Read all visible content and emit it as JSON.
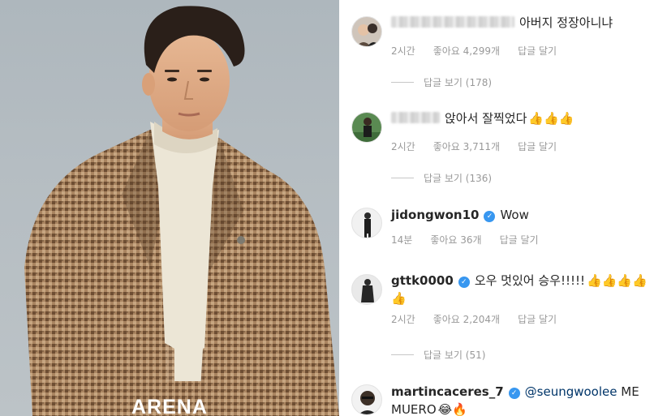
{
  "magazine": {
    "brand": "ARENA"
  },
  "comments": [
    {
      "username": "",
      "username_hidden": true,
      "verified": false,
      "text": "아버지 정장아니냐",
      "emojis": "",
      "time": "2시간",
      "likes": "좋아요 4,299개",
      "reply": "답글 달기",
      "view_replies": "답글 보기 (178)"
    },
    {
      "username": "",
      "username_hidden": true,
      "verified": false,
      "text": "앉아서 잘찍었다",
      "emojis": "👍👍👍",
      "time": "2시간",
      "likes": "좋아요 3,711개",
      "reply": "답글 달기",
      "view_replies": "답글 보기 (136)"
    },
    {
      "username": "jidongwon10",
      "verified": true,
      "text": "Wow",
      "emojis": "",
      "time": "14분",
      "likes": "좋아요 36개",
      "reply": "답글 달기",
      "view_replies": ""
    },
    {
      "username": "gttk0000",
      "verified": true,
      "text": "오우 멋있어 승우!!!!!",
      "emojis": "👍👍👍👍",
      "emojis_line2": "👍",
      "time": "2시간",
      "likes": "좋아요 2,204개",
      "reply": "답글 달기",
      "view_replies": "답글 보기 (51)"
    },
    {
      "username": "martincaceres_7",
      "verified": true,
      "mention": "@seungwoolee",
      "text": "ME",
      "text_line2": "MUERO",
      "emojis": "😂🔥"
    }
  ],
  "colors": {
    "verified": "#3897f0",
    "mention": "#003569",
    "meta": "#999999",
    "text": "#262626"
  }
}
